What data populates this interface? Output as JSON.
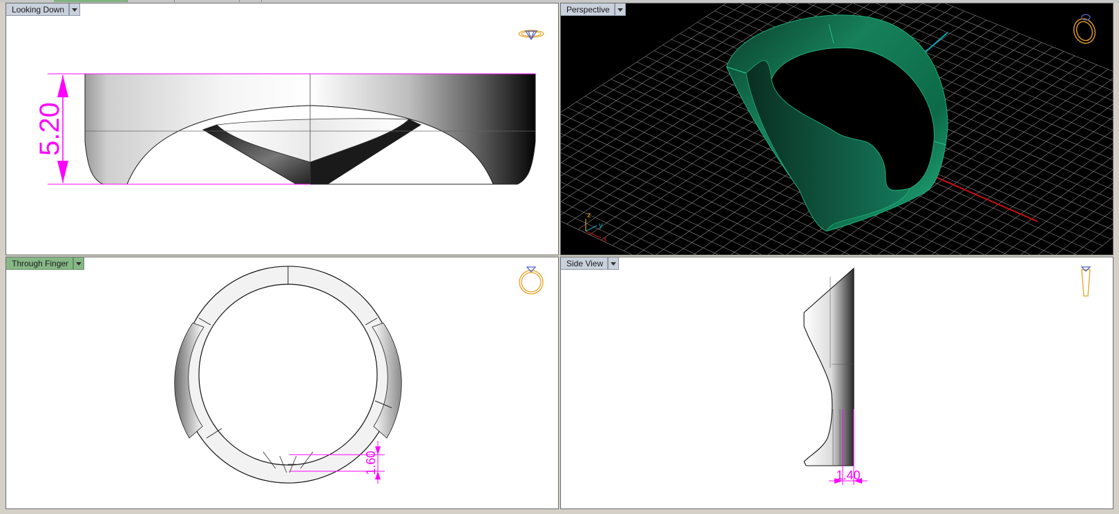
{
  "viewports": {
    "top": {
      "label": "Looking Down"
    },
    "persp": {
      "label": "Perspective"
    },
    "front": {
      "label": "Through Finger"
    },
    "right": {
      "label": "Side View"
    }
  },
  "dimensions": {
    "height": "5.20",
    "thickness": "1.60",
    "width": "1.40"
  },
  "axes": {
    "x": "x",
    "y": "y",
    "z": "z"
  },
  "colors": {
    "active_tab": "#86b886",
    "dimension": "#ff00ff",
    "ring_green": "#0e7a55",
    "x_axis": "#d01010",
    "y_axis": "#0aa8b8",
    "grid": "#8c8c8c",
    "icon": "#e6a020"
  },
  "icons": {
    "top": "ring-top-view-icon",
    "persp": "ring-perspective-icon",
    "front": "ring-front-view-icon",
    "right": "ring-side-view-icon"
  }
}
